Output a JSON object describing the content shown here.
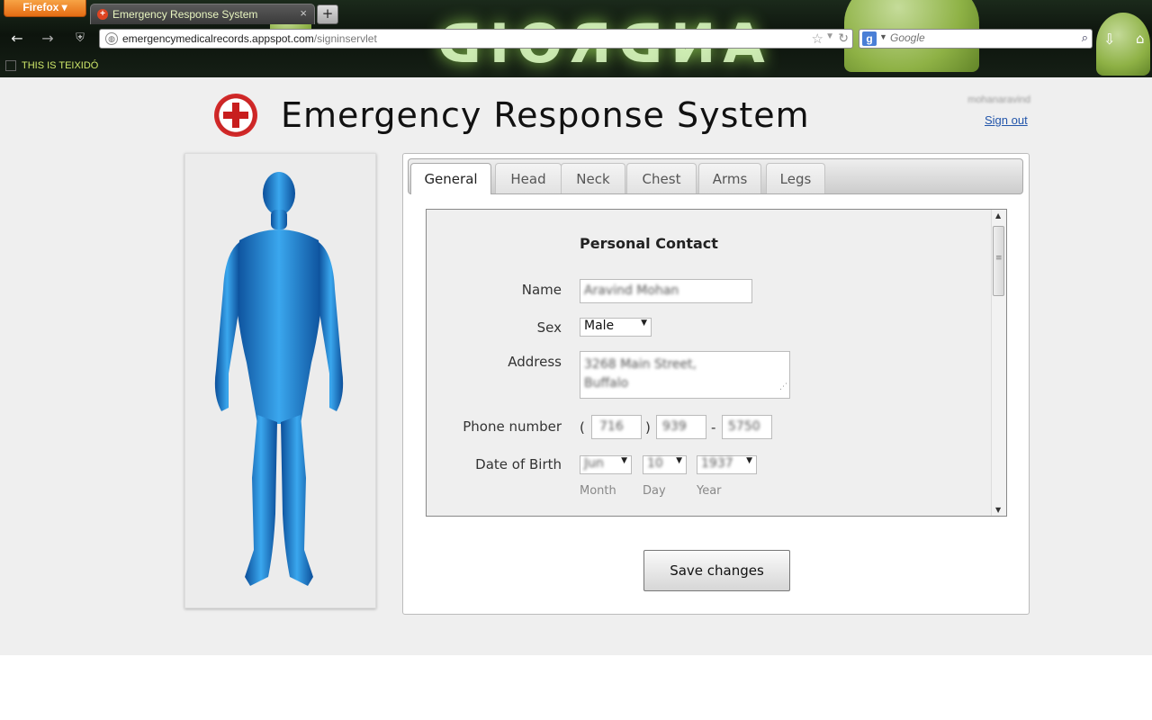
{
  "browser": {
    "menu_button": "Firefox ▾",
    "tab_title": "Emergency Response System",
    "tab_close": "×",
    "new_tab": "+",
    "url_host": "emergencymedicalrecords.appspot.com",
    "url_path": "/signinservlet",
    "search_placeholder": "Google",
    "bookmark_label": "THIS IS TEIXIDÓ",
    "theme_text": "ANDROID"
  },
  "header": {
    "title": "Emergency Response System",
    "username": "mohanaravind",
    "signout_label": "Sign out"
  },
  "tabs": [
    "General",
    "Head",
    "Neck",
    "Chest",
    "Arms",
    "Legs"
  ],
  "active_tab": "General",
  "form": {
    "section_title": "Personal Contact",
    "name_label": "Name",
    "name_value": "Aravind Mohan",
    "sex_label": "Sex",
    "sex_value": "Male",
    "address_label": "Address",
    "address_line1": "3268 Main Street,",
    "address_line2": "Buffalo",
    "phone_label": "Phone number",
    "phone_open": "(",
    "phone_close": ")",
    "phone_dash": "-",
    "phone_area": "716",
    "phone_prefix": "939",
    "phone_line": "5750",
    "dob_label": "Date of Birth",
    "dob_month": "Jun",
    "dob_day": "10",
    "dob_year": "1937",
    "month_label": "Month",
    "day_label": "Day",
    "year_label": "Year"
  },
  "save_label": "Save changes",
  "colors": {
    "body_figure": "#1f7fd1",
    "logo_red": "#c81e1e",
    "link": "#2255aa"
  }
}
